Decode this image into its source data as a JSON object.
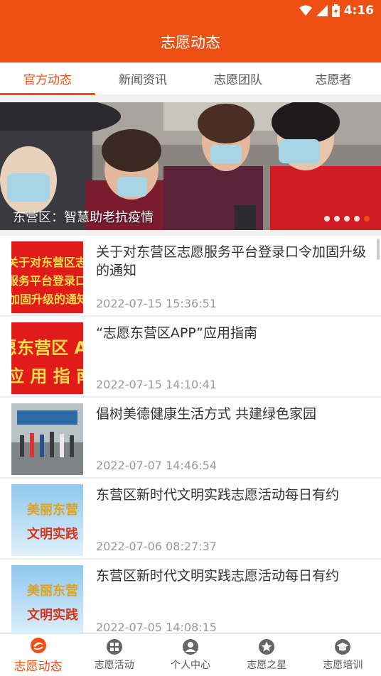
{
  "status": {
    "time": "4:16"
  },
  "header": {
    "title": "志愿动态"
  },
  "tabs": [
    {
      "label": "官方动态",
      "active": true
    },
    {
      "label": "新闻资讯",
      "active": false
    },
    {
      "label": "志愿团队",
      "active": false
    },
    {
      "label": "志愿者",
      "active": false
    }
  ],
  "banner": {
    "caption": "东营区：智慧助老抗疫情",
    "dot_count": 5,
    "active_dot": 5
  },
  "news": [
    {
      "title": "关于对东营区志愿服务平台登录口令加固升级的通知",
      "time": "2022-07-15 15:36:51",
      "thumb_text": [
        "关于对东营区志愿",
        "服务平台登录口令",
        "加固升级的通知"
      ]
    },
    {
      "title": "“志愿东营区APP”应用指南",
      "time": "2022-07-15 14:10:41",
      "thumb_text": [
        "愿东营区 A",
        "应 用 指 南"
      ]
    },
    {
      "title": "倡树美德健康生活方式 共建绿色家园",
      "time": "2022-07-07 14:46:54",
      "thumb_text": []
    },
    {
      "title": "东营区新时代文明实践志愿活动每日有约",
      "time": "2022-07-06 08:27:37",
      "thumb_text": [
        "美丽东营",
        "文明实践"
      ]
    },
    {
      "title": "东营区新时代文明实践志愿活动每日有约",
      "time": "2022-07-05 14:08:15",
      "thumb_text": [
        "美丽东营",
        "文明实践"
      ]
    }
  ],
  "bottom_nav": [
    {
      "label": "志愿动态",
      "icon": "swirl-logo-icon",
      "active": true
    },
    {
      "label": "志愿活动",
      "icon": "grid-icon",
      "active": false
    },
    {
      "label": "个人中心",
      "icon": "user-icon",
      "active": false
    },
    {
      "label": "志愿之星",
      "icon": "star-icon",
      "active": false
    },
    {
      "label": "志愿培训",
      "icon": "graduation-cap-icon",
      "active": false
    }
  ],
  "colors": {
    "brand": "#ee5014",
    "thumb_red": "#e11a1a",
    "thumb_yellow": "#f5dd4b",
    "thumb_sky": "#8fc8ee"
  }
}
